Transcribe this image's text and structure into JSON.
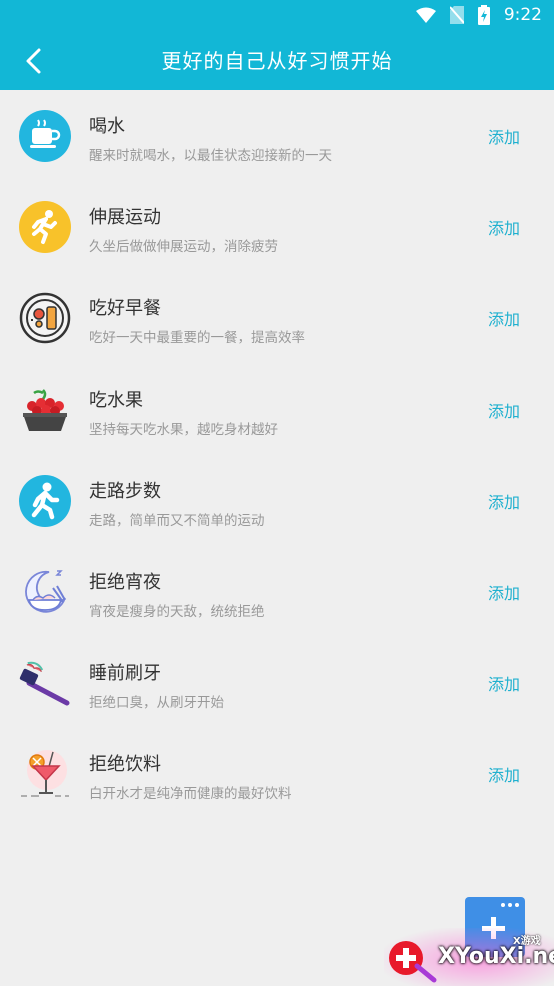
{
  "status": {
    "time": "9:22"
  },
  "header": {
    "title": "更好的自己从好习惯开始"
  },
  "colors": {
    "primary": "#12b7d6",
    "add": "#1fb0cf",
    "fab": "#3f8fe6"
  },
  "habits": [
    {
      "title": "喝水",
      "desc": "醒来时就喝水，以最佳状态迎接新的一天",
      "add": "添加",
      "icon": "cup-icon"
    },
    {
      "title": "伸展运动",
      "desc": "久坐后做做伸展运动，消除疲劳",
      "add": "添加",
      "icon": "running-icon"
    },
    {
      "title": "吃好早餐",
      "desc": "吃好一天中最重要的一餐，提高效率",
      "add": "添加",
      "icon": "breakfast-icon"
    },
    {
      "title": "吃水果",
      "desc": "坚持每天吃水果，越吃身材越好",
      "add": "添加",
      "icon": "fruit-basket-icon"
    },
    {
      "title": "走路步数",
      "desc": "走路，简单而又不简单的运动",
      "add": "添加",
      "icon": "walking-icon"
    },
    {
      "title": "拒绝宵夜",
      "desc": "宵夜是瘦身的天敌，统统拒绝",
      "add": "添加",
      "icon": "moon-night-snack-icon"
    },
    {
      "title": "睡前刷牙",
      "desc": "拒绝口臭，从刷牙开始",
      "add": "添加",
      "icon": "toothbrush-icon"
    },
    {
      "title": "拒绝饮料",
      "desc": "白开水才是纯净而健康的最好饮料",
      "add": "添加",
      "icon": "cocktail-icon"
    }
  ],
  "watermark": {
    "text": "XYouXi.net",
    "small": "X游戏"
  }
}
